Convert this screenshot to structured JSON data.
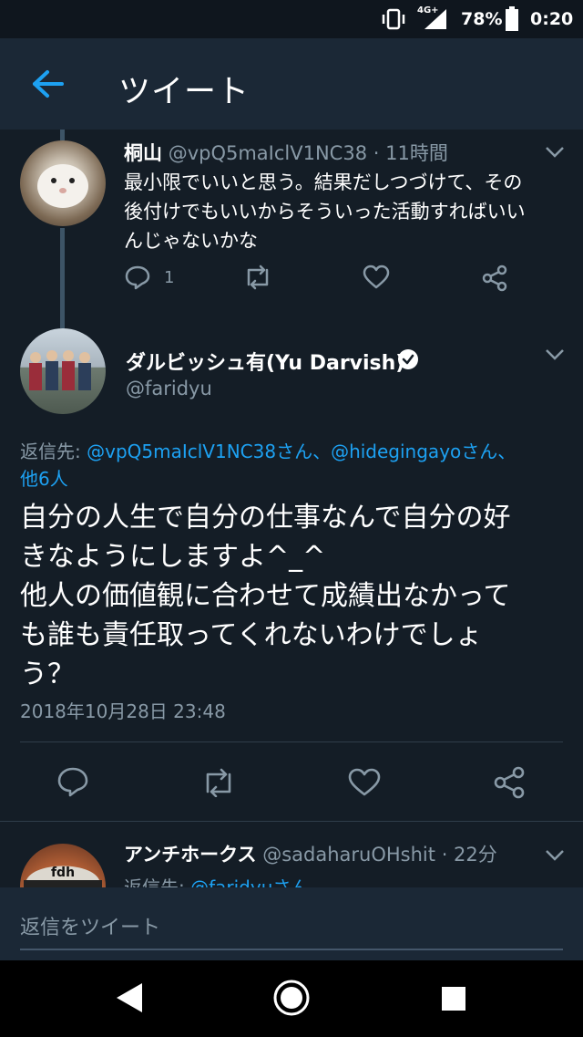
{
  "status_bar": {
    "network": "4G+",
    "battery": "78%",
    "time": "0:20",
    "icons": [
      "vibrate-icon",
      "signal-icon",
      "battery-icon"
    ]
  },
  "header": {
    "title": "ツイート",
    "back_icon": "arrow-left-icon"
  },
  "parent_tweet": {
    "name": "桐山",
    "handle": "@vpQ5maIclV1NC38",
    "time": "· 11時間",
    "text_lines": [
      "最小限でいいと思う。結果だしつづけて、その",
      "後付けでもいいからそういった活動すればいい",
      "んじゃないかな"
    ],
    "reply_count": "1"
  },
  "main_tweet": {
    "name": "ダルビッシュ有(Yu Darvish)",
    "handle": "@faridyu",
    "reply_to_label": "返信先: ",
    "reply_to_1": "@vpQ5maIclV1NC38さん、@hidegingayoさん、",
    "reply_to_2": "他6人",
    "text_lines": [
      "自分の人生で自分の仕事なんで自分の好",
      "きなようにしますよ^_^",
      "他人の価値観に合わせて成績出なかって",
      "も誰も責任取ってくれないわけでしょ",
      "う？"
    ],
    "timestamp": "2018年10月28日 23:48"
  },
  "reply_tweet": {
    "name": "アンチホークス",
    "handle": "@sadaharuOHshit",
    "time": "· 22分",
    "reply_to_label": "返信先: ",
    "reply_to_handle": "@faridyuさん",
    "avatar_text": "fdh"
  },
  "composer": {
    "placeholder": "返信をツイート"
  },
  "colors": {
    "background": "#141d26",
    "header": "#1b2836",
    "accent": "#1da1f2",
    "muted": "#8899a6"
  }
}
